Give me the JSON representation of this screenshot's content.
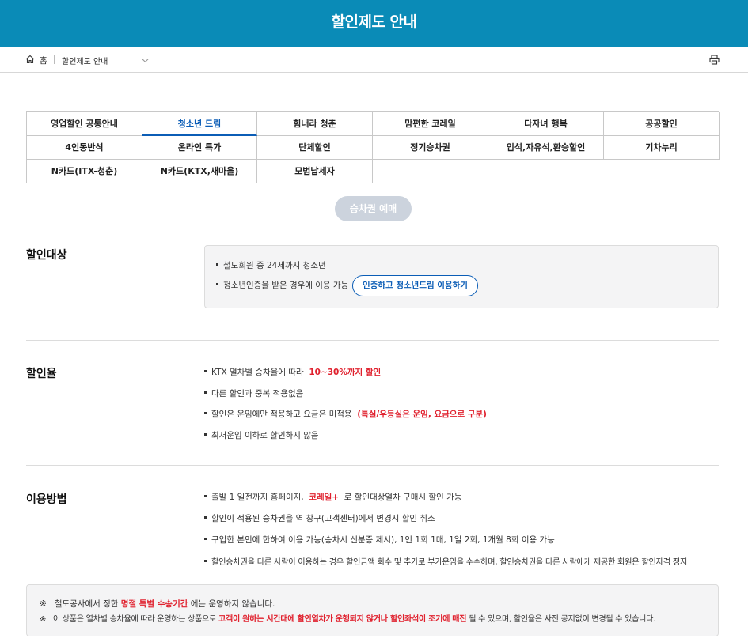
{
  "page": {
    "title": "할인제도 안내"
  },
  "breadcrumb": {
    "home": "홈",
    "current": "할인제도 안내"
  },
  "tabs": [
    "영업할인 공통안내",
    "청소년 드림",
    "힘내라 청춘",
    "맘편한 코레일",
    "다자녀 행복",
    "공공할인",
    "4인동반석",
    "온라인 특가",
    "단체할인",
    "정기승차권",
    "입석,자유석,환승할인",
    "기차누리",
    "N카드(ITX-청춘)",
    "N카드(KTX,새마을)",
    "모범납세자"
  ],
  "active_tab": "청소년 드림",
  "reserve_button": "승차권 예매",
  "target": {
    "title": "할인대상",
    "line1": "철도회원 중 24세까지 청소년",
    "line2": "청소년인증을 받은 경우에 이용 가능",
    "verify_button": "인증하고 청소년드림 이용하기"
  },
  "rate": {
    "title": "할인율",
    "l1_a": "KTX 열차별 승차율에 따라",
    "l1_red": "10~30%까지 할인",
    "l2": "다른 할인과 중복 적용없음",
    "l3_a": "할인은 운임에만 적용하고 요금은 미적용",
    "l3_red": "(특실/우등실은 운임, 요금으로 구분)",
    "l4": "최저운임 이하로 할인하지 않음"
  },
  "usage": {
    "title": "이용방법",
    "l1_a": "출발 1 일전까지 홈페이지,",
    "l1_red": "코레일+",
    "l1_b": "로 할인대상열차 구매시 할인 가능",
    "l2": "할인이 적용된 승차권을 역 창구(고객센터)에서 변경시 할인 취소",
    "l3": "구입한 본인에 한하여 이용 가능(승차시 신분증 제시), 1인 1회 1매, 1일 2회, 1개월 8회 이용 가능",
    "l4": "할인승차권을 다른 사람이 이용하는 경우 할인금액 회수 및 추가로 부가운임을 수수하며, 할인승차권을 다른 사람에게 제공한 회원은 할인자격 정지"
  },
  "notice": {
    "mark": "※",
    "n1_a": "철도공사에서 정한",
    "n1_red": "명절 특별 수송기간",
    "n1_b": "에는 운영하지 않습니다.",
    "n2_a": "이 상품은 열차별 승차율에 따라 운영하는 상품으로",
    "n2_red": "고객이 원하는 시간대에 할인열차가 운행되지 않거나 할인좌석이 조기에 매진",
    "n2_b": "될 수 있으며, 할인율은 사전 공지없이 변경될 수 있습니다."
  },
  "colors": {
    "header": "#0a8bb7",
    "accent": "#0b5db6",
    "highlight": "#e0212e"
  },
  "icons": {
    "home": "home-icon",
    "print": "print-icon",
    "dropdown": "chevron-down-icon"
  }
}
